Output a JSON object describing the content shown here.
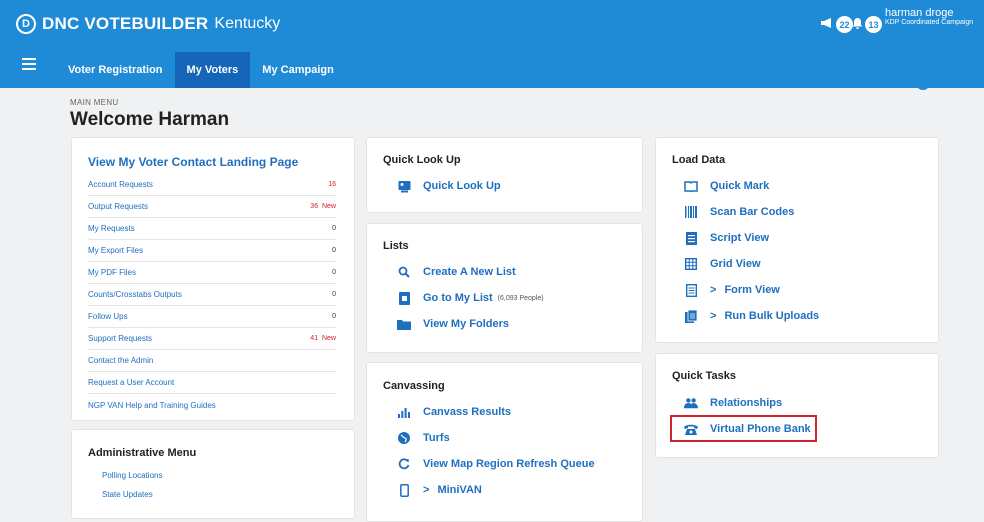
{
  "header": {
    "brand": "DNC VOTEBUILDER",
    "logo": "D",
    "state": "Kentucky",
    "flag_count": "22",
    "bell_count": "13",
    "user_name": "harman droge",
    "campaign": "KDP Coordinated Campaign"
  },
  "nav": {
    "items": [
      "Voter Registration",
      "My Voters",
      "My Campaign"
    ]
  },
  "page": {
    "section": "MAIN MENU",
    "title": "Welcome Harman"
  },
  "voter_contact": {
    "title": "View My Voter Contact Landing Page",
    "rows": [
      {
        "label": "Account Requests",
        "value": "16",
        "flag": ""
      },
      {
        "label": "Output Requests",
        "value": "36",
        "flag": "New"
      },
      {
        "label": "My Requests",
        "value": "0",
        "flag": ""
      },
      {
        "label": "My Export Files",
        "value": "0",
        "flag": ""
      },
      {
        "label": "My PDF Files",
        "value": "0",
        "flag": ""
      },
      {
        "label": "Counts/Crosstabs Outputs",
        "value": "0",
        "flag": ""
      },
      {
        "label": "Follow Ups",
        "value": "0",
        "flag": ""
      },
      {
        "label": "Support Requests",
        "value": "41",
        "flag": "New"
      },
      {
        "label": "Contact the Admin",
        "value": "",
        "flag": ""
      },
      {
        "label": "Request a User Account",
        "value": "",
        "flag": ""
      },
      {
        "label": "NGP VAN Help and Training Guides",
        "value": "",
        "flag": ""
      }
    ]
  },
  "admin": {
    "title": "Administrative Menu",
    "items": [
      "Polling Locations",
      "State Updates"
    ]
  },
  "quick_lookup": {
    "title": "Quick Look Up",
    "link": "Quick Look Up"
  },
  "lists": {
    "title": "Lists",
    "items": [
      {
        "label": "Create A New List",
        "note": ""
      },
      {
        "label": "Go to My List",
        "note": "(6,093 People)"
      },
      {
        "label": "View My Folders",
        "note": ""
      }
    ]
  },
  "canvassing": {
    "title": "Canvassing",
    "items": [
      "Canvass Results",
      "Turfs",
      "View Map Region Refresh Queue",
      "MiniVAN"
    ]
  },
  "load_data": {
    "title": "Load Data",
    "items": [
      "Quick Mark",
      "Scan Bar Codes",
      "Script View",
      "Grid View",
      "Form View",
      "Run Bulk Uploads"
    ]
  },
  "quick_tasks": {
    "title": "Quick Tasks",
    "items": [
      "Relationships",
      "Virtual Phone Bank"
    ]
  },
  "icons": {
    "quick_look": "id-card-icon",
    "search": "search-icon",
    "list": "list-icon",
    "folder": "folder-icon",
    "chart": "bar-chart-icon",
    "globe": "globe-icon",
    "refresh": "refresh-icon",
    "phone": "mobile-icon",
    "book": "book-icon",
    "barcode": "barcode-icon",
    "doc": "document-icon",
    "grid": "grid-icon",
    "form": "form-icon",
    "upload": "bulk-upload-icon",
    "people": "people-icon",
    "telephone": "telephone-icon"
  },
  "colors": {
    "header": "#1f8bd6",
    "active_tab": "#1565b8",
    "link": "#1f6fbf",
    "highlight": "#d2232a"
  }
}
